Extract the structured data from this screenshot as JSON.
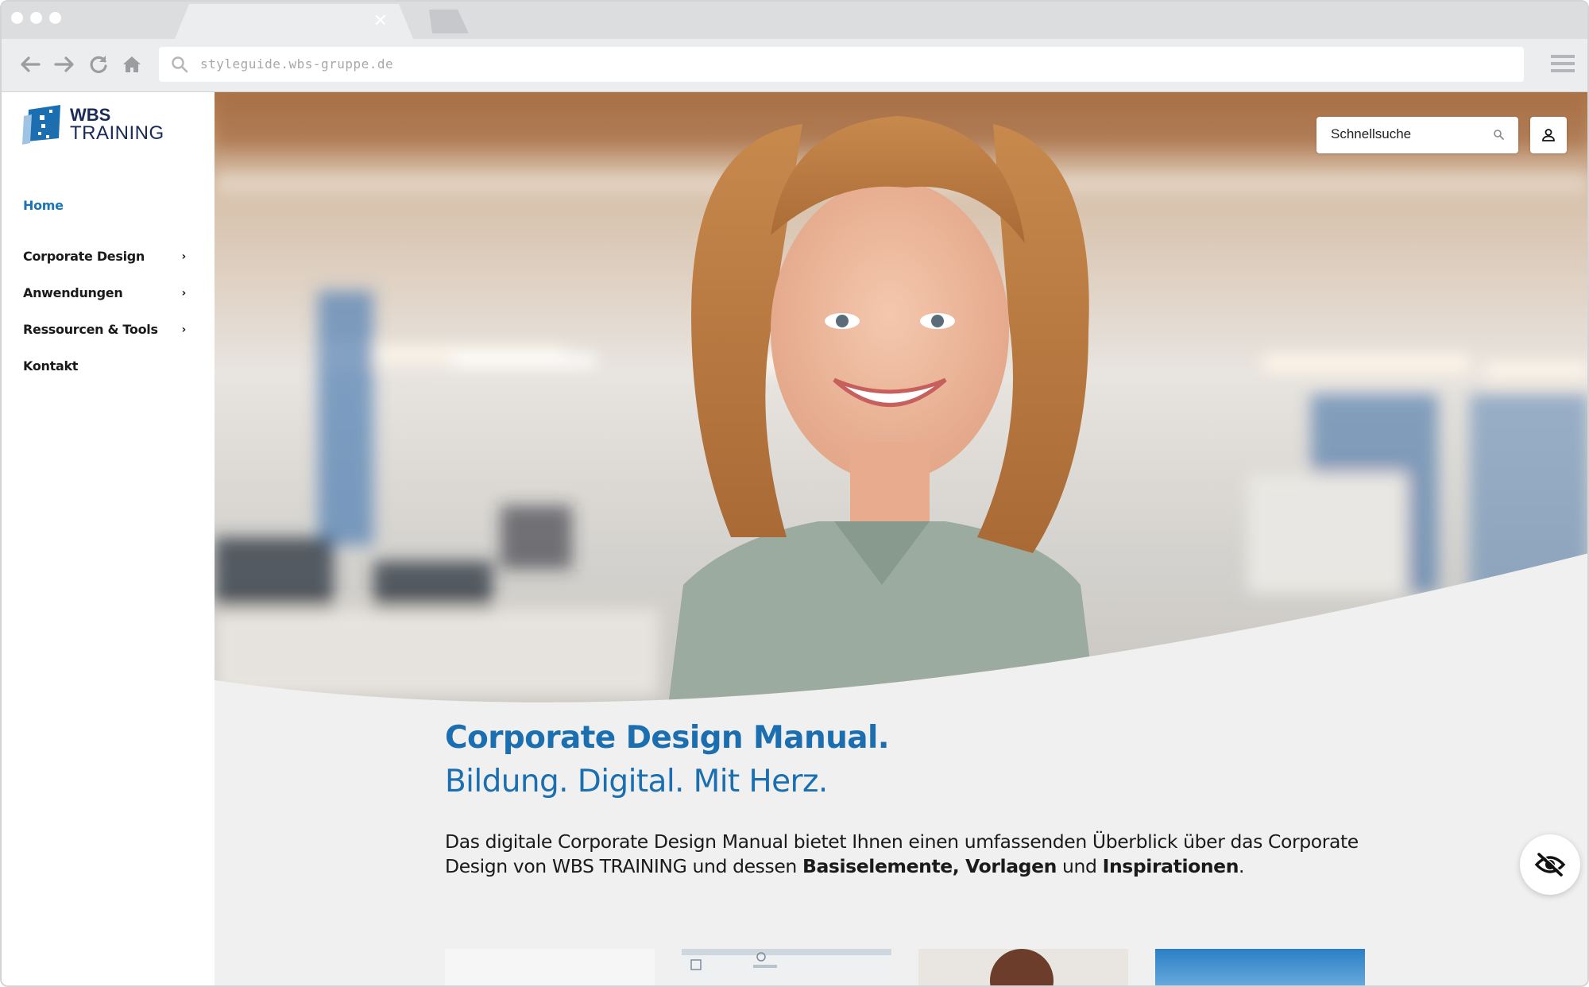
{
  "browser": {
    "url": "styleguide.wbs-gruppe.de",
    "tab_close_label": "✕"
  },
  "brand": {
    "logo_line1": "WBS",
    "logo_line2": "TRAINING",
    "primary_color": "#1b6fb1",
    "navy_color": "#1b2b57"
  },
  "sidebar": {
    "items": [
      {
        "label": "Home",
        "active": true,
        "has_children": false
      },
      {
        "label": "Corporate Design",
        "active": false,
        "has_children": true
      },
      {
        "label": "Anwendungen",
        "active": false,
        "has_children": true
      },
      {
        "label": "Ressourcen & Tools",
        "active": false,
        "has_children": true
      },
      {
        "label": "Kontakt",
        "active": false,
        "has_children": false
      }
    ],
    "chevron": "›"
  },
  "header": {
    "search_placeholder": "Schnellsuche"
  },
  "intro": {
    "title": "Corporate Design Manual.",
    "subtitle": "Bildung. Digital. Mit Herz.",
    "text_part1": "Das digitale Corporate Design Manual bietet Ihnen einen umfassenden Überblick über das Corporate Design von WBS TRAINING und dessen ",
    "bold1": "Basiselemente, Vorlagen",
    "text_part2": " und ",
    "bold2": "Inspirationen",
    "text_part3": "."
  },
  "icons": {
    "search": "search-icon",
    "user": "user-icon",
    "accessibility": "eye-slash-icon",
    "back": "arrow-left-icon",
    "forward": "arrow-right-icon",
    "reload": "reload-icon",
    "home": "home-icon",
    "menu": "hamburger-icon"
  }
}
